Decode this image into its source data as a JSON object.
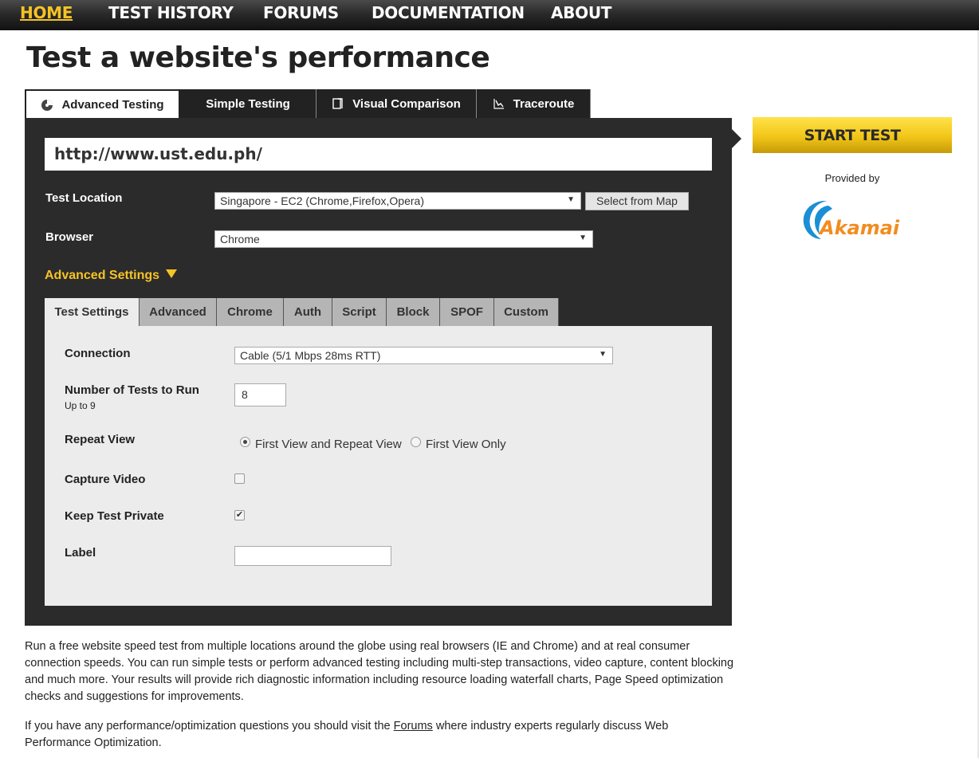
{
  "nav": {
    "home": "HOME",
    "history": "TEST HISTORY",
    "forums": "FORUMS",
    "documentation": "DOCUMENTATION",
    "about": "ABOUT"
  },
  "page_title": "Test a website's performance",
  "tabs": {
    "advanced": "Advanced Testing",
    "simple": "Simple Testing",
    "visual": "Visual Comparison",
    "traceroute": "Traceroute"
  },
  "url_value": "http://www.ust.edu.ph/",
  "test_location": {
    "label": "Test Location",
    "value": "Singapore - EC2 (Chrome,Firefox,Opera)",
    "map_button": "Select from Map"
  },
  "browser": {
    "label": "Browser",
    "value": "Chrome"
  },
  "advanced_settings_label": "Advanced Settings",
  "subtabs": {
    "test_settings": "Test Settings",
    "advanced": "Advanced",
    "chrome": "Chrome",
    "auth": "Auth",
    "script": "Script",
    "block": "Block",
    "spof": "SPOF",
    "custom": "Custom"
  },
  "settings": {
    "connection_label": "Connection",
    "connection_value": "Cable (5/1 Mbps 28ms RTT)",
    "num_tests_label": "Number of Tests to Run",
    "num_tests_hint": "Up to 9",
    "num_tests_value": "8",
    "repeat_view_label": "Repeat View",
    "repeat_option_1": "First View and Repeat View",
    "repeat_option_2": "First View Only",
    "capture_video_label": "Capture Video",
    "capture_video_checked": false,
    "keep_private_label": "Keep Test Private",
    "keep_private_checked": true,
    "label_label": "Label",
    "label_value": ""
  },
  "start_button": "START TEST",
  "provided_by": "Provided by",
  "sponsor": "Akamai",
  "description": {
    "p1": "Run a free website speed test from multiple locations around the globe using real browsers (IE and Chrome) and at real consumer connection speeds. You can run simple tests or perform advanced testing including multi-step transactions, video capture, content blocking and much more. Your results will provide rich diagnostic information including resource loading waterfall charts, Page Speed optimization checks and suggestions for improvements.",
    "p2_before": "If you have any performance/optimization questions you should visit the ",
    "p2_link": "Forums",
    "p2_after": " where industry experts regularly discuss Web Performance Optimization."
  },
  "colors": {
    "accent_yellow": "#f6c325",
    "panel_dark": "#2b2b2b",
    "akamai_orange": "#f28c1e",
    "akamai_blue": "#1a8fd6"
  }
}
